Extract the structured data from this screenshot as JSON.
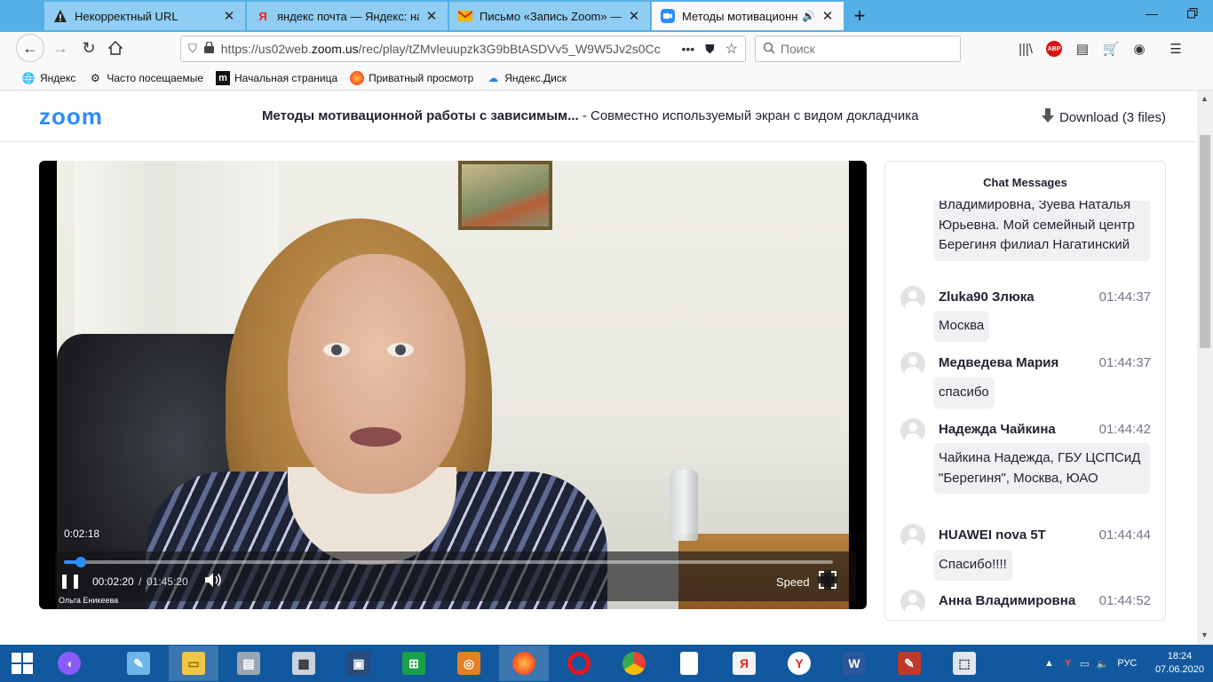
{
  "browser": {
    "tabs": [
      {
        "title": "Некорректный URL",
        "icon": "warning-icon"
      },
      {
        "title": "яндекс почта — Яндекс: нашлось",
        "icon": "yandex-icon"
      },
      {
        "title": "Письмо «Запись Zoom» — Кузьмина",
        "icon": "mail-icon"
      },
      {
        "title": "Методы мотивационной р",
        "icon": "zoom-icon",
        "active": true
      }
    ],
    "url_prefix": "https://us02web.",
    "url_domain": "zoom.us",
    "url_rest": "/rec/play/tZMvleuupzk3G9bBtASDVv5_W9W5Jv2s0Cc",
    "url_more": "•••",
    "search_placeholder": "Поиск",
    "bookmarks": [
      {
        "label": "Яндекс",
        "icon": "globe-icon"
      },
      {
        "label": "Часто посещаемые",
        "icon": "gear-icon"
      },
      {
        "label": "Начальная страница",
        "icon": "m-logo-icon"
      },
      {
        "label": "Приватный просмотр",
        "icon": "firefox-icon"
      },
      {
        "label": "Яндекс.Диск",
        "icon": "disk-icon"
      }
    ]
  },
  "zoom": {
    "logo": "zoom",
    "title_bold": "Методы мотивационной работы с зависимым...",
    "title_rest": " - Совместно используемый экран с видом докладчика",
    "download": "Download (3 files)"
  },
  "player": {
    "hover_time": "0:02:18",
    "current_time": "00:02:20",
    "separator": "/",
    "total_time": "01:45:20",
    "progress": 0.022,
    "speed_label": "Speed",
    "speaker_name": "Ольга Еникеева"
  },
  "chat": {
    "title": "Chat Messages",
    "partial_message": "Владимировна, Зуева Наталья Юрьевна. Мой семейный центр Берегиня филиал Нагатинский",
    "messages": [
      {
        "sender": "Zluka90 Злюка",
        "time": "01:44:37",
        "text": "Москва"
      },
      {
        "sender": "Медведева Мария",
        "time": "01:44:37",
        "text": "спасибо"
      },
      {
        "sender": "Надежда Чайкина",
        "time": "01:44:42",
        "text": "Чайкина Надежда, ГБУ ЦСПСиД \"Берегиня\", Москва, ЮАО"
      },
      {
        "sender": "HUAWEI nova 5T",
        "time": "01:44:44",
        "text": "Спасибо!!!!"
      },
      {
        "sender": "Анна Владимировна",
        "time": "01:44:52",
        "text": ""
      }
    ]
  },
  "taskbar": {
    "lang": "РУС",
    "time": "18:24",
    "date": "07.06.2020"
  },
  "colors": {
    "zoom_blue": "#2d8cff",
    "tab_strip": "#56b0e6",
    "taskbar": "#11589e"
  }
}
